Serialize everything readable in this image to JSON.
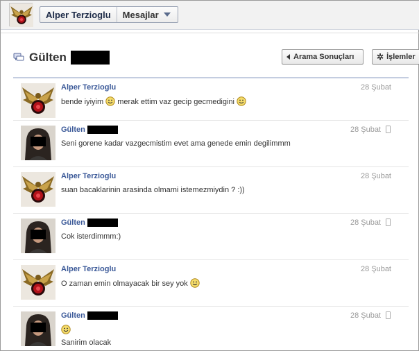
{
  "header": {
    "user_name": "Alper Terzioglu",
    "section": "Mesajlar"
  },
  "conversation": {
    "title": "Gülten",
    "back_button": "Arama Sonuçları",
    "actions_button": "İşlemler"
  },
  "messages": [
    {
      "sender": "Alper Terzioglu",
      "date": "28 Şubat",
      "text_a": "bende iyiyim",
      "text_b": "merak ettim vaz gecip gecmedigini",
      "avatar": "eagle-emblem",
      "mobile": false
    },
    {
      "sender": "Gülten",
      "date": "28 Şubat",
      "text_a": "Seni gorene kadar vazgecmistim evet ama genede emin degilimmm",
      "avatar": "person-photo",
      "mobile": true
    },
    {
      "sender": "Alper Terzioglu",
      "date": "28 Şubat",
      "text_a": "suan bacaklarinin arasinda olmami istemezmiydin ? :))",
      "avatar": "eagle-emblem",
      "mobile": false
    },
    {
      "sender": "Gülten",
      "date": "28 Şubat",
      "text_a": "Cok isterdimmm:)",
      "avatar": "person-photo",
      "mobile": true
    },
    {
      "sender": "Alper Terzioglu",
      "date": "28 Şubat",
      "text_a": "O zaman emin olmayacak bir sey yok",
      "avatar": "eagle-emblem",
      "mobile": false
    },
    {
      "sender": "Gülten",
      "date": "28 Şubat",
      "text_a": "Sanirim olacak",
      "avatar": "person-photo",
      "mobile": true
    }
  ],
  "colors": {
    "link_blue": "#3b5998",
    "date_gray": "#999999",
    "divider": "#c4cde0"
  }
}
